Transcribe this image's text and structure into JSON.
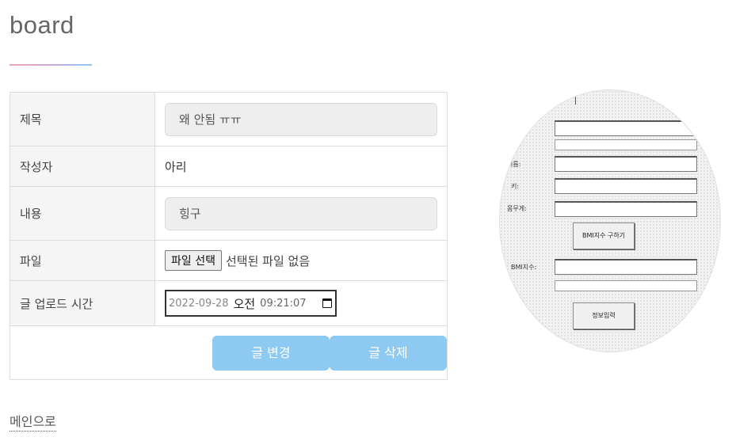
{
  "page": {
    "title": "board"
  },
  "form": {
    "rows": {
      "title": {
        "label": "제목",
        "value": "왜 안됨 ㅠㅠ"
      },
      "author": {
        "label": "작성자",
        "value": "아리"
      },
      "content": {
        "label": "내용",
        "value": "힝구"
      },
      "file": {
        "label": "파일",
        "button_label": "파일 선택",
        "status": "선택된 파일 없음"
      },
      "upload_time": {
        "label": "글 업로드 시간",
        "date": "2022-09-28",
        "ampm": "오전",
        "time": "09:21:07"
      }
    },
    "buttons": {
      "edit": "글 변경",
      "delete": "글 삭제"
    }
  },
  "footer": {
    "main_link": "메인으로"
  },
  "embedded_image": {
    "labels": {
      "name": "이름:",
      "height": "키:",
      "weight": "몸무게:",
      "bmi": "BMI지수:"
    },
    "bmi_button": "BMI지수 구하기",
    "save_button": "정보입력"
  },
  "colors": {
    "accent_button": "#8ec9f1",
    "underline_start": "#f0a3b8",
    "underline_end": "#8ec9f1"
  }
}
